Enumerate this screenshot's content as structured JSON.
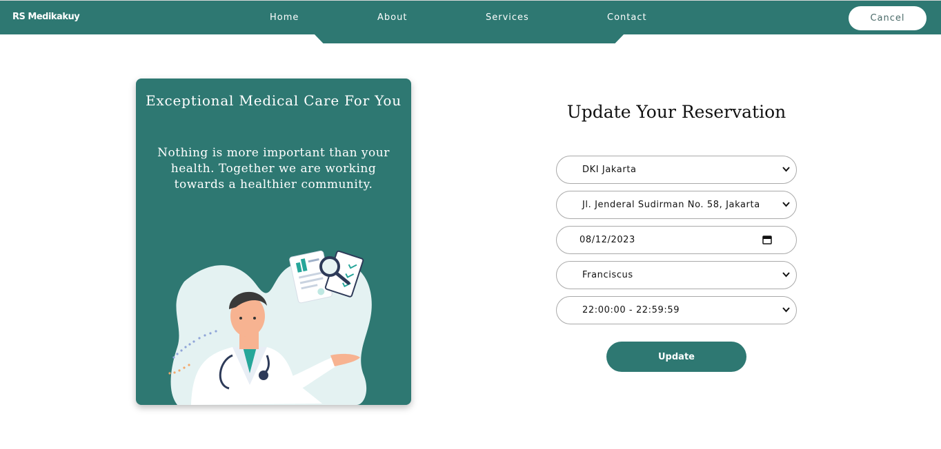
{
  "nav": {
    "brand": "RS Medikakuy",
    "links": [
      "Home",
      "About",
      "Services",
      "Contact"
    ],
    "cancel_label": "Cancel"
  },
  "card": {
    "title": "Exceptional Medical Care For You",
    "description": "Nothing is more important than your health. Together we are working towards a healthier community."
  },
  "form": {
    "title": "Update Your Reservation",
    "province": "DKI Jakarta",
    "hospital": "Jl. Jenderal Sudirman No. 58, Jakarta",
    "date": "08/12/2023",
    "doctor": "Franciscus",
    "time_slot": "22:00:00 - 22:59:59",
    "update_label": "Update"
  },
  "colors": {
    "primary": "#2e7872",
    "white": "#ffffff"
  }
}
